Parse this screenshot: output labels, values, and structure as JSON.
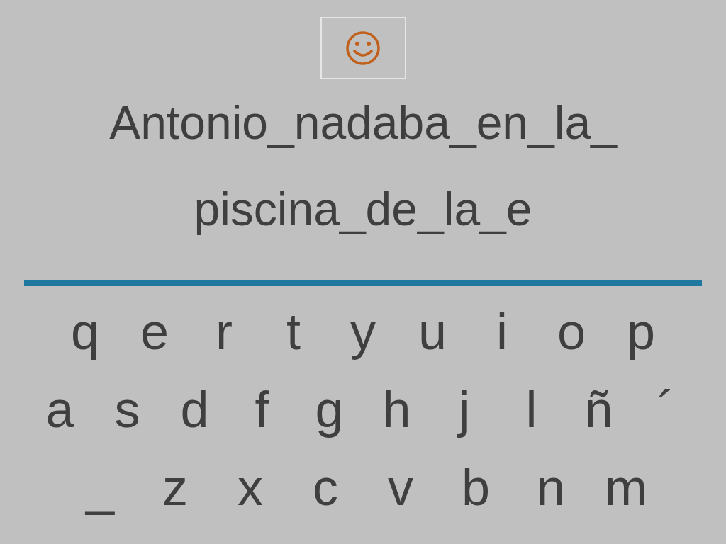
{
  "phrase_lines": [
    "Antonio_nadaba_en_la_",
    "piscina_de_la_e"
  ],
  "keyboard": [
    [
      "q",
      "e",
      "r",
      "t",
      "y",
      "u",
      "i",
      "o",
      "p"
    ],
    [
      "a",
      "s",
      "d",
      "f",
      "g",
      "h",
      "j",
      "l",
      "ñ",
      "´"
    ],
    [
      "_",
      "z",
      "x",
      "c",
      "v",
      "b",
      "n",
      "m"
    ]
  ]
}
